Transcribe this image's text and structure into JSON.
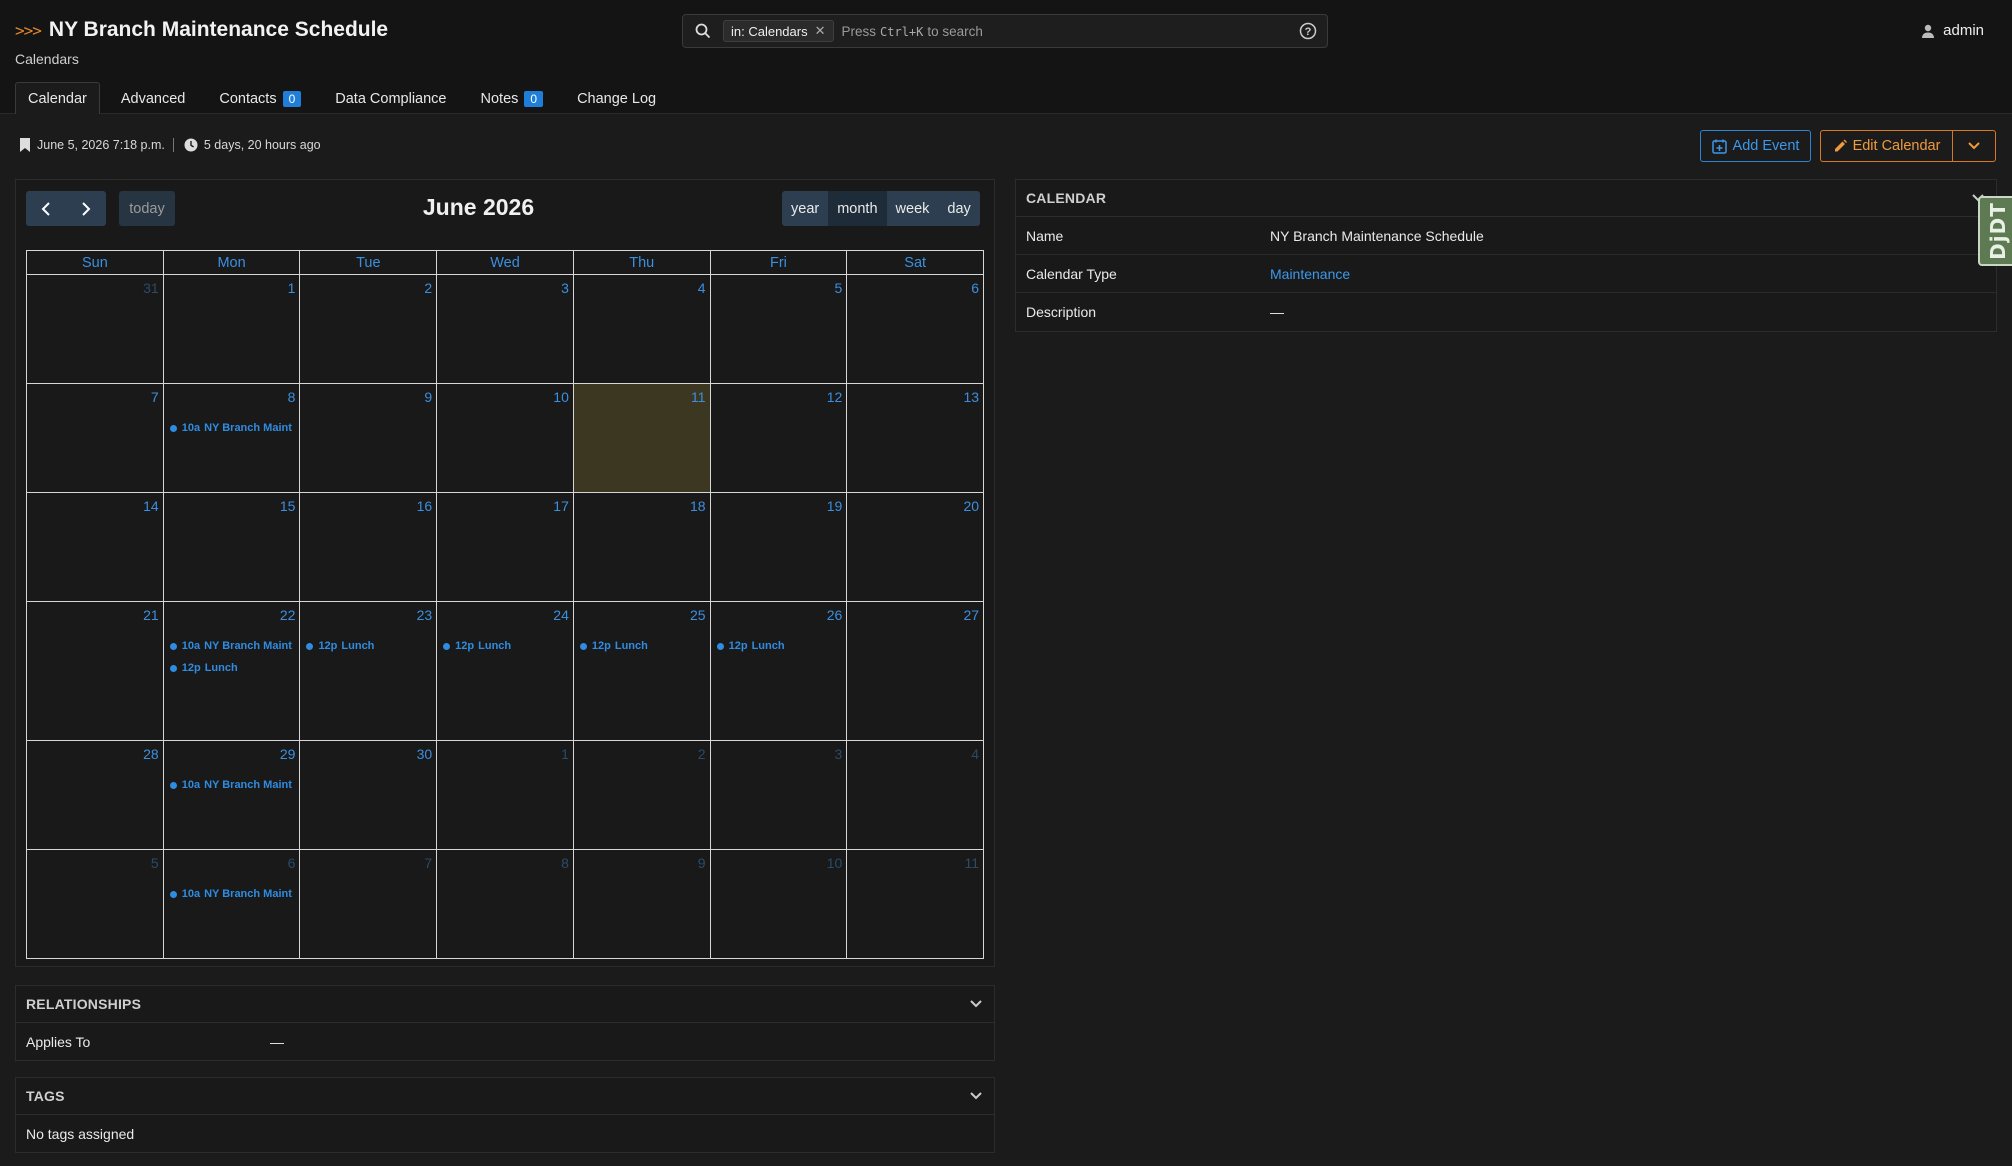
{
  "header": {
    "title": "NY Branch Maintenance Schedule",
    "breadcrumb": "Calendars",
    "search": {
      "chip": "in: Calendars",
      "hint_press": "Press",
      "hint_key": "Ctrl+K",
      "hint_rest": "to search"
    },
    "user": "admin"
  },
  "tabs": [
    {
      "label": "Calendar",
      "active": true
    },
    {
      "label": "Advanced"
    },
    {
      "label": "Contacts",
      "badge": "0"
    },
    {
      "label": "Data Compliance"
    },
    {
      "label": "Notes",
      "badge": "0"
    },
    {
      "label": "Change Log"
    }
  ],
  "meta": {
    "created": "June 5, 2026 7:18 p.m.",
    "updated": "5 days, 20 hours ago"
  },
  "actions": {
    "add_event": "Add Event",
    "edit_calendar": "Edit Calendar"
  },
  "calendar": {
    "title": "June 2026",
    "today_label": "today",
    "views": [
      "year",
      "month",
      "week",
      "day"
    ],
    "days_of_week": [
      "Sun",
      "Mon",
      "Tue",
      "Wed",
      "Thu",
      "Fri",
      "Sat"
    ],
    "weeks": [
      [
        {
          "n": "31",
          "other": true
        },
        {
          "n": "1"
        },
        {
          "n": "2"
        },
        {
          "n": "3"
        },
        {
          "n": "4"
        },
        {
          "n": "5"
        },
        {
          "n": "6"
        }
      ],
      [
        {
          "n": "7"
        },
        {
          "n": "8",
          "events": [
            {
              "time": "10a",
              "title": "NY Branch Maint"
            }
          ]
        },
        {
          "n": "9"
        },
        {
          "n": "10"
        },
        {
          "n": "11",
          "today": true
        },
        {
          "n": "12"
        },
        {
          "n": "13"
        }
      ],
      [
        {
          "n": "14"
        },
        {
          "n": "15"
        },
        {
          "n": "16"
        },
        {
          "n": "17"
        },
        {
          "n": "18"
        },
        {
          "n": "19"
        },
        {
          "n": "20"
        }
      ],
      [
        {
          "n": "21"
        },
        {
          "n": "22",
          "events": [
            {
              "time": "10a",
              "title": "NY Branch Maint"
            },
            {
              "time": "12p",
              "title": "Lunch"
            }
          ]
        },
        {
          "n": "23",
          "events": [
            {
              "time": "12p",
              "title": "Lunch"
            }
          ]
        },
        {
          "n": "24",
          "events": [
            {
              "time": "12p",
              "title": "Lunch"
            }
          ]
        },
        {
          "n": "25",
          "events": [
            {
              "time": "12p",
              "title": "Lunch"
            }
          ]
        },
        {
          "n": "26",
          "events": [
            {
              "time": "12p",
              "title": "Lunch"
            }
          ]
        },
        {
          "n": "27"
        }
      ],
      [
        {
          "n": "28"
        },
        {
          "n": "29",
          "events": [
            {
              "time": "10a",
              "title": "NY Branch Maint"
            }
          ]
        },
        {
          "n": "30"
        },
        {
          "n": "1",
          "other": true
        },
        {
          "n": "2",
          "other": true
        },
        {
          "n": "3",
          "other": true
        },
        {
          "n": "4",
          "other": true
        }
      ],
      [
        {
          "n": "5",
          "other": true
        },
        {
          "n": "6",
          "other": true,
          "events": [
            {
              "time": "10a",
              "title": "NY Branch Maint"
            }
          ]
        },
        {
          "n": "7",
          "other": true
        },
        {
          "n": "8",
          "other": true
        },
        {
          "n": "9",
          "other": true
        },
        {
          "n": "10",
          "other": true
        },
        {
          "n": "11",
          "other": true
        }
      ]
    ]
  },
  "details": {
    "heading": "CALENDAR",
    "rows": [
      {
        "key": "Name",
        "value": "NY Branch Maintenance Schedule"
      },
      {
        "key": "Calendar Type",
        "value": "Maintenance",
        "link": true
      },
      {
        "key": "Description",
        "value": "—"
      }
    ]
  },
  "relationships": {
    "heading": "RELATIONSHIPS",
    "key": "Applies To",
    "value": "—"
  },
  "tags": {
    "heading": "TAGS",
    "empty": "No tags assigned"
  },
  "debug_toolbar": {
    "label": "DjDT"
  }
}
